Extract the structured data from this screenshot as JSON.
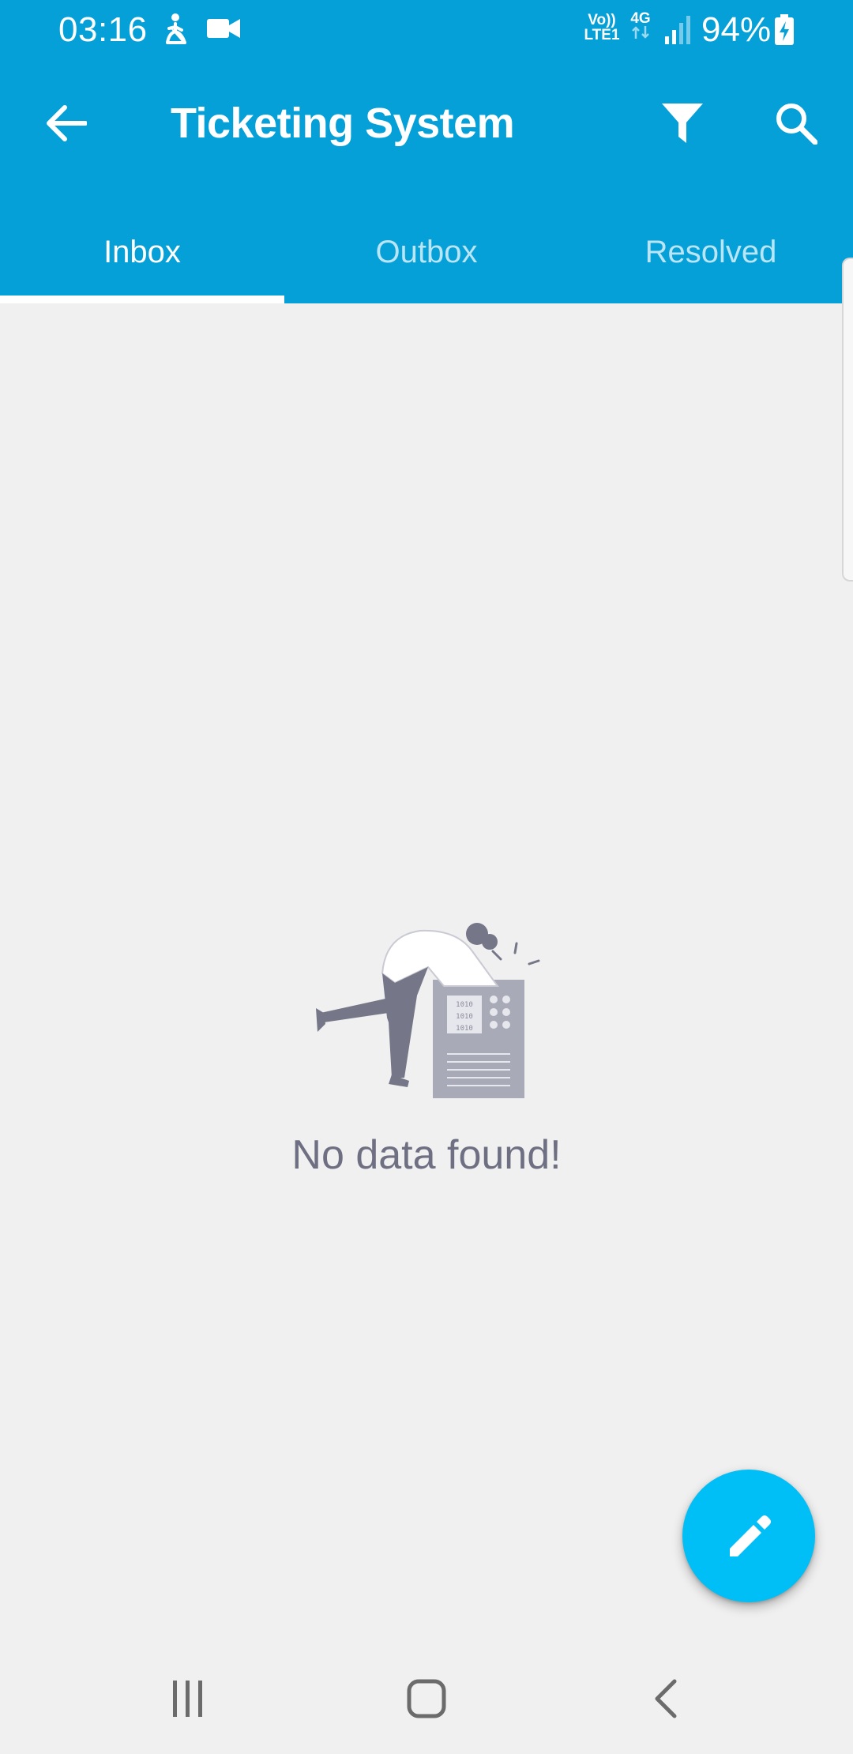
{
  "status_bar": {
    "time": "03:16",
    "network_label": "Vo))\nLTE1",
    "network_type": "4G",
    "battery": "94%",
    "icons": [
      "accessibility-icon",
      "video-camera-icon",
      "signal-icon",
      "battery-charging-icon"
    ]
  },
  "app_bar": {
    "title": "Ticketing System",
    "back_icon": "arrow-back-icon",
    "filter_icon": "filter-icon",
    "search_icon": "search-icon"
  },
  "tabs": [
    {
      "label": "Inbox",
      "active": true
    },
    {
      "label": "Outbox",
      "active": false
    },
    {
      "label": "Resolved",
      "active": false
    }
  ],
  "empty_state": {
    "message": "No data found!",
    "illustration": "person-searching-in-box-illustration",
    "illustration_text": "1010"
  },
  "fab": {
    "icon": "pencil-icon"
  },
  "nav_bar": {
    "icons": [
      "recent-apps-icon",
      "home-icon",
      "back-icon"
    ]
  },
  "colors": {
    "primary": "#04a0d7",
    "fab": "#00bef6",
    "background": "#f0f0f0",
    "empty_text": "#6e6f82"
  }
}
